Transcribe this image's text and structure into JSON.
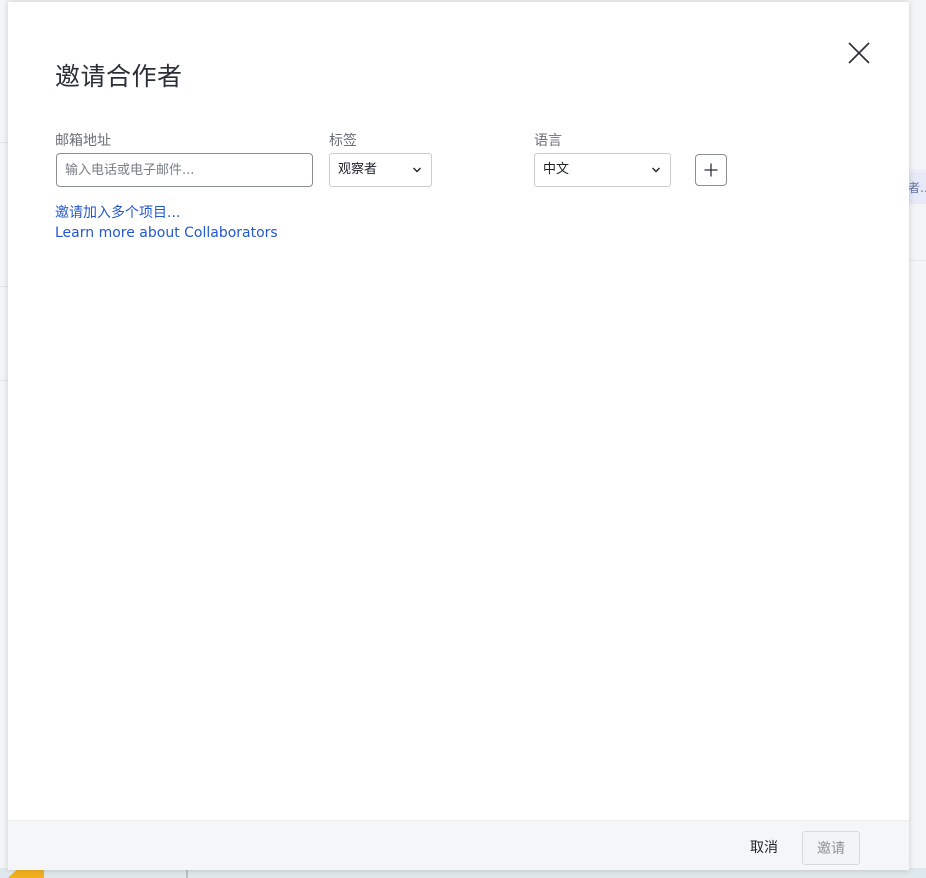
{
  "dialog": {
    "title": "邀请合作者",
    "close_icon": "close-icon"
  },
  "form": {
    "email": {
      "label": "邮箱地址",
      "value": "",
      "placeholder": "输入电话或电子邮件..."
    },
    "role": {
      "label": "标签",
      "selected": "观察者"
    },
    "language": {
      "label": "语言",
      "selected": "中文"
    },
    "add_row_icon": "plus-icon"
  },
  "links": {
    "invite_multiple": "邀请加入多个项目...",
    "learn_more": "Learn more about Collaborators"
  },
  "footer": {
    "cancel_label": "取消",
    "invite_label": "邀请"
  },
  "background": {
    "chip_text": "者..."
  },
  "colors": {
    "link": "#2458d0",
    "text": "#2b2f36",
    "muted_label": "#6b6f76",
    "disabled_button_bg": "#f3f4f5"
  }
}
